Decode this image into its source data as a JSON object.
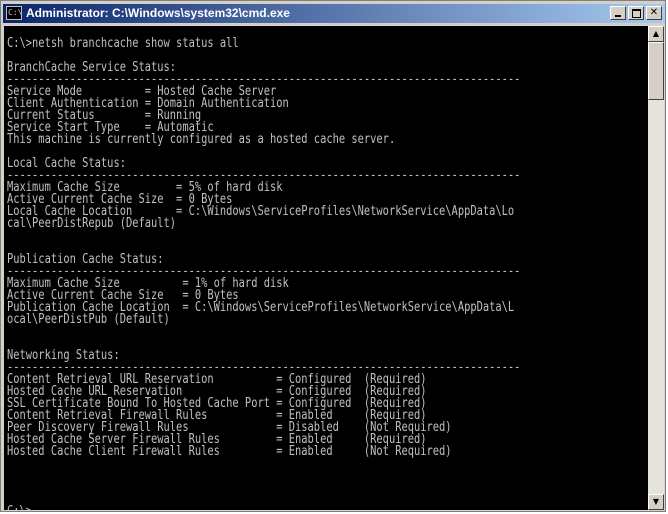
{
  "window": {
    "title": "Administrator: C:\\Windows\\system32\\cmd.exe",
    "icon_label": "C:\\"
  },
  "console": {
    "lines": [
      "C:\\>netsh branchcache show status all",
      "",
      "BranchCache Service Status:",
      "----------------------------------------------------------------------------------",
      "Service Mode          = Hosted Cache Server",
      "Client Authentication = Domain Authentication",
      "Current Status        = Running",
      "Service Start Type    = Automatic",
      "This machine is currently configured as a hosted cache server.",
      "",
      "Local Cache Status:",
      "----------------------------------------------------------------------------------",
      "Maximum Cache Size         = 5% of hard disk",
      "Active Current Cache Size  = 0 Bytes",
      "Local Cache Location       = C:\\Windows\\ServiceProfiles\\NetworkService\\AppData\\Lo",
      "cal\\PeerDistRepub (Default)",
      "",
      "",
      "Publication Cache Status:",
      "----------------------------------------------------------------------------------",
      "Maximum Cache Size          = 1% of hard disk",
      "Active Current Cache Size   = 0 Bytes",
      "Publication Cache Location  = C:\\Windows\\ServiceProfiles\\NetworkService\\AppData\\L",
      "ocal\\PeerDistPub (Default)",
      "",
      "",
      "Networking Status:",
      "----------------------------------------------------------------------------------",
      "Content Retrieval URL Reservation          = Configured  (Required)",
      "Hosted Cache URL Reservation               = Configured  (Required)",
      "SSL Certificate Bound To Hosted Cache Port = Configured  (Required)",
      "Content Retrieval Firewall Rules           = Enabled     (Required)",
      "Peer Discovery Firewall Rules              = Disabled    (Not Required)",
      "Hosted Cache Server Firewall Rules         = Enabled     (Required)",
      "Hosted Cache Client Firewall Rules         = Enabled     (Not Required)",
      "",
      "",
      "",
      ""
    ],
    "prompt": "C:\\>"
  },
  "icons": {
    "minimize": "minimize-icon",
    "maximize": "maximize-icon",
    "close": "close-icon",
    "scroll_up": "arrow-up-icon",
    "scroll_down": "arrow-down-icon"
  },
  "colors": {
    "console_bg": "#000000",
    "console_fg": "#c0c0c0",
    "titlebar_start": "#0a246a",
    "titlebar_end": "#a6caf0"
  }
}
